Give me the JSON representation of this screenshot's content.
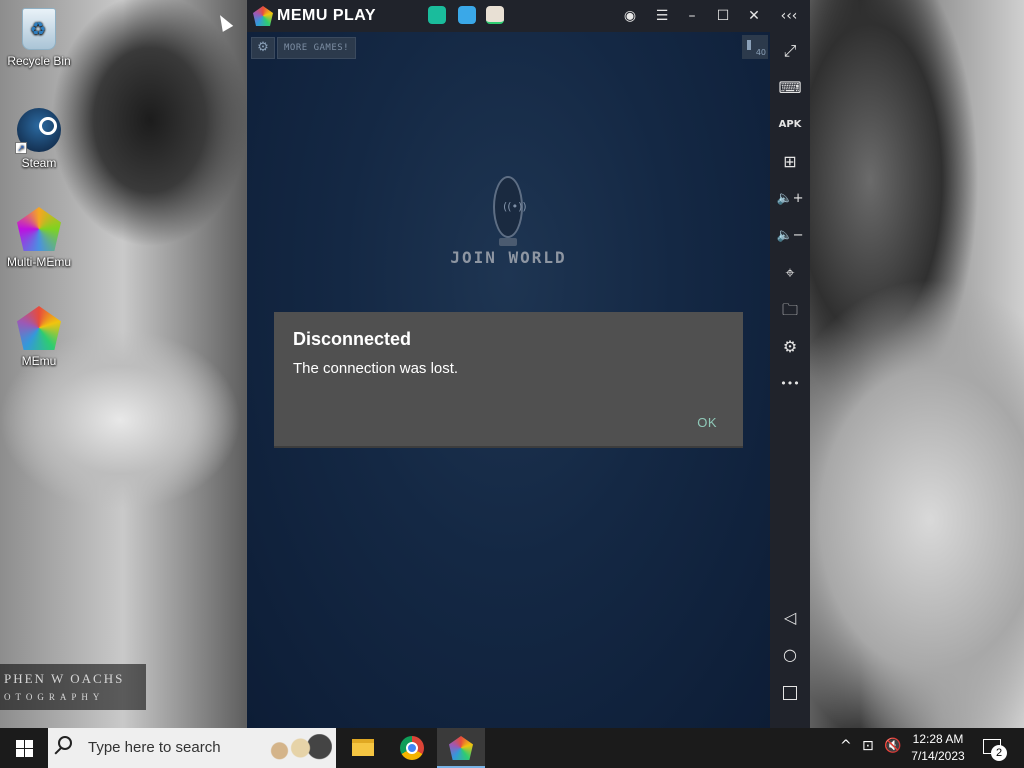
{
  "desktop": {
    "icons": [
      {
        "label": "Recycle Bin",
        "icon": "recycle-bin-icon"
      },
      {
        "label": "Steam",
        "icon": "steam-icon"
      },
      {
        "label": "Multi-MEmu",
        "icon": "multi-memu-icon"
      },
      {
        "label": "MEmu",
        "icon": "memu-icon"
      }
    ],
    "watermark": {
      "line1": "PHEN W OACHS",
      "line2": "OTOGRAPHY"
    }
  },
  "emulator": {
    "app_name": "MEMU PLAY",
    "tabs": [
      "app-tab-1",
      "app-tab-2",
      "app-tab-3"
    ],
    "titlebar_buttons": {
      "account": "◉",
      "menu": "☰",
      "minimize": "–",
      "maximize": "☐",
      "close": "✕",
      "collapse": "‹‹‹"
    },
    "game": {
      "settings_glyph": "⚙",
      "more_games_label": "MORE GAMES!",
      "video_counter": "40",
      "join_world_label": "JOIN WORLD"
    },
    "dialog": {
      "title": "Disconnected",
      "message": "The connection was lost.",
      "ok_label": "OK"
    },
    "sidebar": {
      "fullscreen": "⤢",
      "keyboard": "⌨",
      "apk_label": "APK",
      "multi_window": "⊞",
      "volume_up": "🔈+",
      "volume_down": "🔈−",
      "location": "⌖",
      "folder": "🗀",
      "settings": "⚙",
      "more": "•••",
      "back": "◁",
      "home": "○"
    }
  },
  "taskbar": {
    "search_placeholder": "Type here to search",
    "apps": [
      "file-explorer",
      "chrome",
      "memu"
    ],
    "tray": {
      "chevron": "^",
      "network": "⊡",
      "volume": "🔇"
    },
    "time": "12:28 AM",
    "date": "7/14/2023",
    "notification_count": "2"
  },
  "colors": {
    "dialog_bg": "#505050",
    "ok_text": "#8fc9b8",
    "sidebar_bg": "#20232b",
    "game_bg": "#142844"
  }
}
